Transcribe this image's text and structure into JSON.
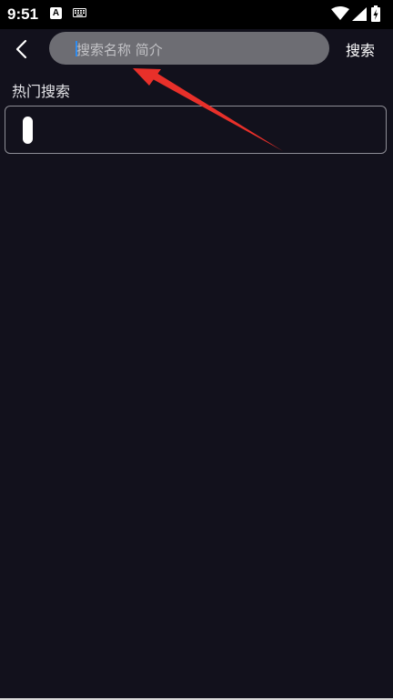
{
  "status_bar": {
    "time": "9:51",
    "notification_letter": "A",
    "icons": [
      "keyboard-icon",
      "wifi-icon",
      "signal-icon",
      "battery-icon"
    ]
  },
  "header": {
    "back_icon": "chevron-left-icon",
    "search_placeholder": "搜索名称 简介",
    "search_action_label": "搜索"
  },
  "hot_search": {
    "title": "热门搜索"
  },
  "colors": {
    "background": "#12111c",
    "search_box": "#6d6d73",
    "annotation_arrow": "#e8302a",
    "caret": "#2e8cf0"
  }
}
